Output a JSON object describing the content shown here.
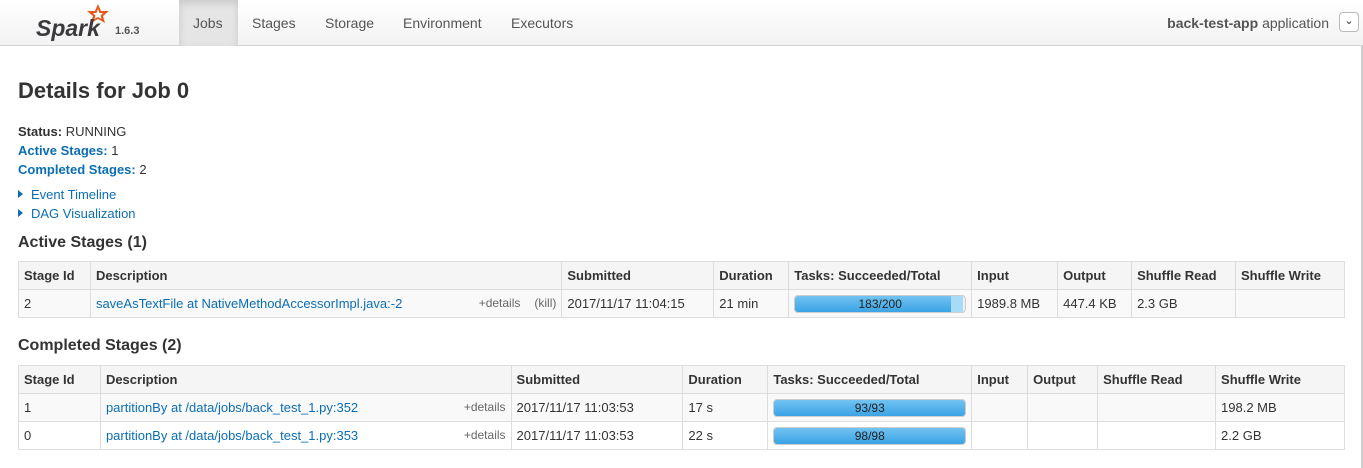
{
  "navbar": {
    "brand": "Spark",
    "version": "1.6.3",
    "tabs": [
      {
        "label": "Jobs",
        "active": true
      },
      {
        "label": "Stages",
        "active": false
      },
      {
        "label": "Storage",
        "active": false
      },
      {
        "label": "Environment",
        "active": false
      },
      {
        "label": "Executors",
        "active": false
      }
    ],
    "app_name": "back-test-app",
    "app_suffix": "application",
    "caret": "⌄"
  },
  "page": {
    "title": "Details for Job 0",
    "status_label": "Status:",
    "status_value": "RUNNING",
    "active_stages_label": "Active Stages:",
    "active_stages_value": "1",
    "completed_stages_label": "Completed Stages:",
    "completed_stages_value": "2",
    "event_timeline": "Event Timeline",
    "dag_visualization": "DAG Visualization"
  },
  "active": {
    "heading": "Active Stages (1)",
    "headers": [
      "Stage Id",
      "Description",
      "Submitted",
      "Duration",
      "Tasks: Succeeded/Total",
      "Input",
      "Output",
      "Shuffle Read",
      "Shuffle Write"
    ],
    "rows": [
      {
        "stage_id": "2",
        "description": "saveAsTextFile at NativeMethodAccessorImpl.java:-2",
        "details": "+details",
        "kill": "(kill)",
        "submitted": "2017/11/17 11:04:15",
        "duration": "21 min",
        "tasks": "183/200",
        "progress": 0.915,
        "running": 0.075,
        "input": "1989.8 MB",
        "output": "447.4 KB",
        "shuffle_read": "2.3 GB",
        "shuffle_write": ""
      }
    ]
  },
  "completed": {
    "heading": "Completed Stages (2)",
    "headers": [
      "Stage Id",
      "Description",
      "Submitted",
      "Duration",
      "Tasks: Succeeded/Total",
      "Input",
      "Output",
      "Shuffle Read",
      "Shuffle Write"
    ],
    "rows": [
      {
        "stage_id": "1",
        "description": "partitionBy at /data/jobs/back_test_1.py:352",
        "details": "+details",
        "submitted": "2017/11/17 11:03:53",
        "duration": "17 s",
        "tasks": "93/93",
        "progress": 1.0,
        "input": "",
        "output": "",
        "shuffle_read": "",
        "shuffle_write": "198.2 MB"
      },
      {
        "stage_id": "0",
        "description": "partitionBy at /data/jobs/back_test_1.py:353",
        "details": "+details",
        "submitted": "2017/11/17 11:03:53",
        "duration": "22 s",
        "tasks": "98/98",
        "progress": 1.0,
        "input": "",
        "output": "",
        "shuffle_read": "",
        "shuffle_write": "2.2 GB"
      }
    ]
  }
}
